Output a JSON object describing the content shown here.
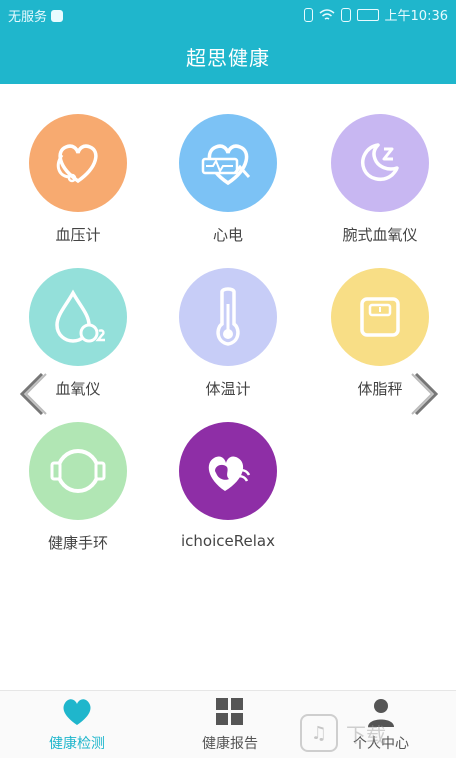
{
  "status": {
    "carrier": "无服务",
    "time": "上午10:36"
  },
  "title": "超思健康",
  "devices": [
    {
      "label": "血压计",
      "color": "#f7aa70",
      "icon": "stethoscope-heart-icon"
    },
    {
      "label": "心电",
      "color": "#7cc2f5",
      "icon": "ecg-heart-icon"
    },
    {
      "label": "腕式血氧仪",
      "color": "#c8b7f2",
      "icon": "moon-sleep-icon"
    },
    {
      "label": "血氧仪",
      "color": "#94e0da",
      "icon": "oxygen-drop-icon"
    },
    {
      "label": "体温计",
      "color": "#c7cdf7",
      "icon": "thermometer-icon"
    },
    {
      "label": "体脂秤",
      "color": "#f8de86",
      "icon": "scale-icon"
    },
    {
      "label": "健康手环",
      "color": "#b1e6b4",
      "icon": "wristband-icon"
    },
    {
      "label": "ichoiceRelax",
      "color": "#8e2ea6",
      "icon": "relax-heart-icon"
    }
  ],
  "tabs": [
    {
      "label": "健康检测",
      "icon": "heart-icon",
      "active": true,
      "color": "#1fb6cc"
    },
    {
      "label": "健康报告",
      "icon": "grid-icon",
      "active": false,
      "color": "#555555"
    },
    {
      "label": "个人中心",
      "icon": "person-icon",
      "active": false,
      "color": "#555555"
    }
  ],
  "watermark": {
    "text": "下载"
  }
}
